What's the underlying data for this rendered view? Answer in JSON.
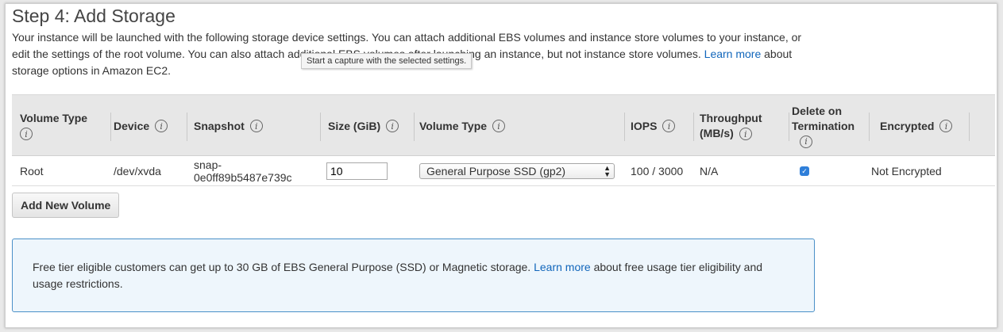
{
  "step": {
    "title": "Step 4: Add Storage"
  },
  "description": {
    "part1": "Your instance will be launched with the following storage device settings. You can attach additional EBS volumes and instance store volumes to your instance, or edit the settings of the root volume. You can also attach additional EBS volumes after launching an instance, but not instance store volumes. ",
    "link": "Learn more",
    "part2": " about storage options in Amazon EC2."
  },
  "tooltip": {
    "text": "Start a capture with the selected settings."
  },
  "table": {
    "headers": {
      "volume_type_1": "Volume Type",
      "device": "Device",
      "snapshot": "Snapshot",
      "size": "Size (GiB)",
      "volume_type_2": "Volume Type",
      "iops": "IOPS",
      "throughput_1": "Throughput",
      "throughput_2": "(MB/s)",
      "delete_1": "Delete on",
      "delete_2": "Termination",
      "encrypted": "Encrypted"
    },
    "info_glyph": "i",
    "row": {
      "volume_type": "Root",
      "device": "/dev/xvda",
      "snapshot_1": "snap-",
      "snapshot_2": "0e0ff89b5487e739c",
      "size": "10",
      "vol_type_select": "General Purpose SSD (gp2)",
      "iops": "100 / 3000",
      "throughput": "N/A",
      "delete_on_termination": true,
      "encrypted": "Not Encrypted"
    }
  },
  "add_button": {
    "label": "Add New Volume"
  },
  "notice": {
    "part1": "Free tier eligible customers can get up to 30 GB of EBS General Purpose (SSD) or Magnetic storage. ",
    "link": "Learn more",
    "part2": " about free usage tier eligibility and usage restrictions."
  },
  "colors": {
    "link": "#1166bb",
    "notice_border": "#4a90c8",
    "notice_bg": "#eef6fc",
    "checkbox": "#2f7fd9"
  }
}
